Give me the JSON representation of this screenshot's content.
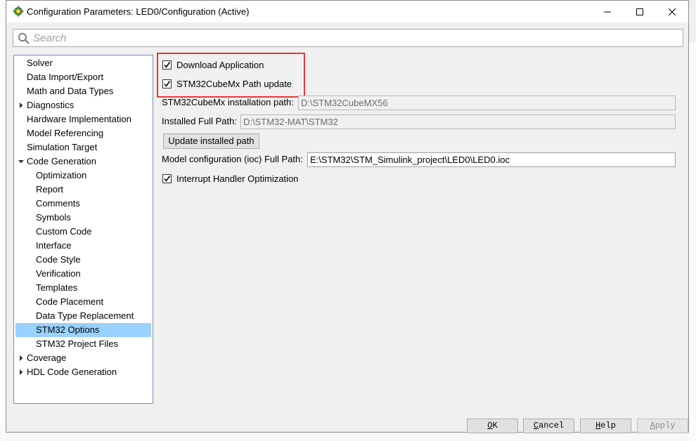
{
  "window": {
    "title": "Configuration Parameters: LED0/Configuration (Active)"
  },
  "search": {
    "placeholder": "Search"
  },
  "tree": {
    "items": [
      {
        "label": "Solver",
        "level": 0,
        "expander": "none",
        "selected": false
      },
      {
        "label": "Data Import/Export",
        "level": 0,
        "expander": "none",
        "selected": false
      },
      {
        "label": "Math and Data Types",
        "level": 0,
        "expander": "none",
        "selected": false
      },
      {
        "label": "Diagnostics",
        "level": 0,
        "expander": "collapsed",
        "selected": false
      },
      {
        "label": "Hardware Implementation",
        "level": 0,
        "expander": "none",
        "selected": false
      },
      {
        "label": "Model Referencing",
        "level": 0,
        "expander": "none",
        "selected": false
      },
      {
        "label": "Simulation Target",
        "level": 0,
        "expander": "none",
        "selected": false
      },
      {
        "label": "Code Generation",
        "level": 0,
        "expander": "expanded",
        "selected": false
      },
      {
        "label": "Optimization",
        "level": 1,
        "expander": "none",
        "selected": false
      },
      {
        "label": "Report",
        "level": 1,
        "expander": "none",
        "selected": false
      },
      {
        "label": "Comments",
        "level": 1,
        "expander": "none",
        "selected": false
      },
      {
        "label": "Symbols",
        "level": 1,
        "expander": "none",
        "selected": false
      },
      {
        "label": "Custom Code",
        "level": 1,
        "expander": "none",
        "selected": false
      },
      {
        "label": "Interface",
        "level": 1,
        "expander": "none",
        "selected": false
      },
      {
        "label": "Code Style",
        "level": 1,
        "expander": "none",
        "selected": false
      },
      {
        "label": "Verification",
        "level": 1,
        "expander": "none",
        "selected": false
      },
      {
        "label": "Templates",
        "level": 1,
        "expander": "none",
        "selected": false
      },
      {
        "label": "Code Placement",
        "level": 1,
        "expander": "none",
        "selected": false
      },
      {
        "label": "Data Type Replacement",
        "level": 1,
        "expander": "none",
        "selected": false
      },
      {
        "label": "STM32 Options",
        "level": 1,
        "expander": "none",
        "selected": true
      },
      {
        "label": "STM32 Project Files",
        "level": 1,
        "expander": "none",
        "selected": false
      },
      {
        "label": "Coverage",
        "level": 0,
        "expander": "collapsed",
        "selected": false
      },
      {
        "label": "HDL Code Generation",
        "level": 0,
        "expander": "collapsed",
        "selected": false
      }
    ]
  },
  "options": {
    "download_application": {
      "label": "Download Application",
      "checked": true
    },
    "cubemx_path_update": {
      "label": "STM32CubeMx Path update",
      "checked": true
    },
    "cubemx_install_path": {
      "label": "STM32CubeMx installation path:",
      "value": "D:\\STM32CubeMX56"
    },
    "installed_full_path": {
      "label": "Installed Full Path:",
      "value": "D:\\STM32-MAT\\STM32"
    },
    "update_button": "Update installed path",
    "model_config_path": {
      "label": "Model configuration (ioc) Full Path:",
      "value": "E:\\STM32\\STM_Simulink_project\\LED0\\LED0.ioc"
    },
    "interrupt_handler": {
      "label": "Interrupt Handler Optimization",
      "checked": true
    }
  },
  "buttons": {
    "ok": {
      "accel": "O",
      "rest": "K"
    },
    "cancel": {
      "accel": "C",
      "rest": "ancel"
    },
    "help": {
      "accel": "H",
      "rest": "elp"
    },
    "apply": {
      "accel": "A",
      "rest": "pply",
      "enabled": false
    }
  },
  "colors": {
    "selection": "#99d1ff",
    "highlight_box": "#e53935",
    "tree_border": "#6f8fb8"
  }
}
